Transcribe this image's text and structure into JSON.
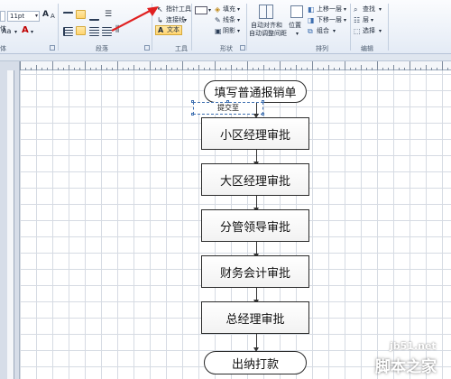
{
  "ribbon": {
    "font": {
      "size_value": "11pt",
      "label_partial": "体",
      "grow_label": "Aa",
      "group_partial": "体"
    },
    "paragraph": {
      "group_label": "段落"
    },
    "tools": {
      "pointer_label": "指针工具",
      "connector_label": "连接线",
      "text_label": "文本",
      "group_label": "工具"
    },
    "shape": {
      "fill_label": "填充",
      "line_label": "线条",
      "shadow_label": "阴影",
      "group_label": "形状"
    },
    "arrange": {
      "auto_align_label": "自动对齐和",
      "auto_align_label2": "自动调整间距",
      "position_label": "位置",
      "bring_forward_label": "上移一层",
      "send_backward_label": "下移一层",
      "group_cmd_label": "组合",
      "group_label": "排列"
    },
    "edit": {
      "find_label": "查找",
      "layer_label": "层",
      "select_label": "选择",
      "group_label": "编辑"
    }
  },
  "flowchart": {
    "start": "填写普通报销单",
    "textbox": "提交至",
    "steps": [
      "小区经理审批",
      "大区经理审批",
      "分管领导审批",
      "财务会计审批",
      "总经理审批"
    ],
    "end": "出纳打款"
  },
  "watermark": {
    "line1": "jb51.net",
    "line2": "脚本之家"
  },
  "colors": {
    "annotation_arrow": "#e02020",
    "ribbon_bg": "#e4ebf5",
    "selection": "#3e6fb0"
  }
}
